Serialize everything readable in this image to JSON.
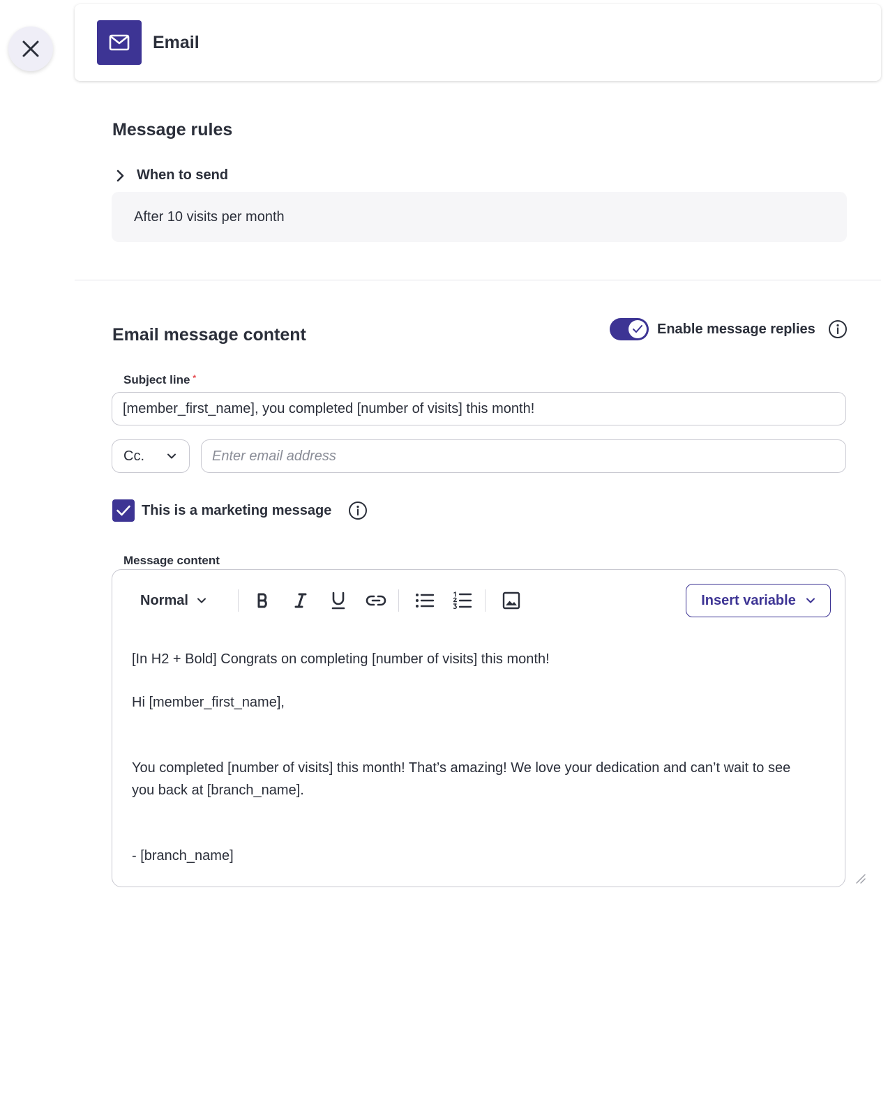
{
  "header": {
    "title": "Email"
  },
  "message_rules": {
    "title": "Message rules",
    "when_to_send_label": "When to send",
    "rule_value": "After 10 visits per month"
  },
  "email_content": {
    "title": "Email message content",
    "enable_replies_label": "Enable message replies",
    "enable_replies_on": true,
    "subject_label": "Subject line",
    "subject_required_mark": "*",
    "subject_value": "[member_first_name], you completed [number of visits] this month!",
    "cc_option": "Cc.",
    "email_placeholder": "Enter email address",
    "marketing_label": "This is a marketing message",
    "marketing_checked": true,
    "message_content_label": "Message content"
  },
  "toolbar": {
    "format_value": "Normal",
    "insert_variable_label": "Insert variable"
  },
  "editor": {
    "line1": "[In H2 + Bold] Congrats on completing [number of visits] this month!",
    "line2": "Hi [member_first_name],",
    "line3": "You completed [number of visits] this month! That’s amazing! We love your dedication and can’t wait to see you back at [branch_name].",
    "line4": "- [branch_name]"
  },
  "colors": {
    "accent": "#3d3494",
    "text": "#2b2f3a",
    "border": "#c9c9d1",
    "rule_bg": "#f6f6f8",
    "required": "#e5484d"
  },
  "icons": {
    "close": "close-icon",
    "email": "mail-icon",
    "chevron_right": "chevron-right-icon",
    "info": "info-icon",
    "check": "check-icon",
    "chevron_down": "chevron-down-icon",
    "bold": "bold-icon",
    "italic": "italic-icon",
    "underline": "underline-icon",
    "link": "link-icon",
    "bullet_list": "bullet-list-icon",
    "numbered_list": "numbered-list-icon",
    "image": "image-icon",
    "resize": "resize-handle-icon"
  }
}
